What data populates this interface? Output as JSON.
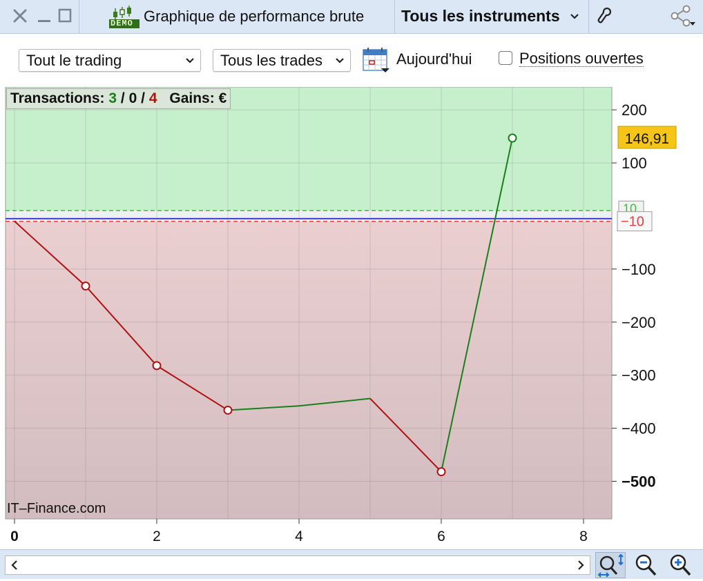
{
  "window": {
    "title": "Graphique de performance brute",
    "demo_badge": "DEMO",
    "instrument_selector": "Tous les instruments",
    "icons": [
      "close-icon",
      "minimize-icon",
      "maximize-icon",
      "wrench-icon",
      "share-icon"
    ]
  },
  "toolbar": {
    "trading_select": "Tout le trading",
    "trades_select": "Tous les trades",
    "date_label": "Aujourd'hui",
    "open_positions_label": "Positions ouvertes",
    "open_positions_checked": false
  },
  "summary": {
    "transactions_label": "Transactions:",
    "wins": "3",
    "sep1": "/",
    "even": "0",
    "sep2": "/",
    "losses": "4",
    "gains_label": "Gains:",
    "currency": "€"
  },
  "watermark": "IT–Finance.com",
  "chart_data": {
    "type": "line",
    "x": [
      0,
      1,
      2,
      3,
      4,
      5,
      6,
      7
    ],
    "y": [
      -10,
      -132,
      -282,
      -366,
      -358,
      -344,
      -482,
      146.91
    ],
    "markers_at": [
      1,
      2,
      3,
      6,
      7
    ],
    "xlim": [
      0,
      8.5
    ],
    "ylim": [
      -545,
      240
    ],
    "x_ticks": [
      "0",
      "2",
      "4",
      "6",
      "8"
    ],
    "x_tick_values": [
      0,
      2,
      4,
      6,
      8
    ],
    "y_ticks": [
      "200",
      "100",
      "−100",
      "−200",
      "−300",
      "−400",
      "−500"
    ],
    "y_tick_values": [
      200,
      100,
      -100,
      -200,
      -300,
      -400,
      -500
    ],
    "last_value_label": "146,91",
    "upper_threshold": 10,
    "upper_threshold_label": "10",
    "lower_threshold": -10,
    "lower_threshold_label": "−10",
    "zero_line": -5,
    "colors": {
      "gain": "#1a7f1a",
      "loss": "#b01010",
      "gain_zone": "#c6efcc",
      "loss_zone_top": "#ebcfd0",
      "loss_zone_bottom": "#d2bcc0",
      "last_value_bg": "#f5c518",
      "zero_line": "#3b3bd6"
    },
    "grid": true
  }
}
